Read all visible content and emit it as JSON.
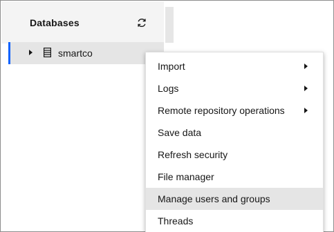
{
  "panel": {
    "title": "Databases",
    "refresh_icon": "refresh-icon"
  },
  "tree": {
    "selected_item": {
      "label": "smartco",
      "icon": "database-icon",
      "expander_icon": "caret-right-icon"
    },
    "accent_color": "#0f62fe"
  },
  "context_menu": {
    "items": [
      {
        "label": "Import",
        "has_submenu": true
      },
      {
        "label": "Logs",
        "has_submenu": true
      },
      {
        "label": "Remote repository operations",
        "has_submenu": true
      },
      {
        "label": "Save data",
        "has_submenu": false
      },
      {
        "label": "Refresh security",
        "has_submenu": false
      },
      {
        "label": "File manager",
        "has_submenu": false
      },
      {
        "label": "Manage users and groups",
        "has_submenu": false,
        "highlighted": true
      },
      {
        "label": "Threads",
        "has_submenu": false
      }
    ]
  }
}
